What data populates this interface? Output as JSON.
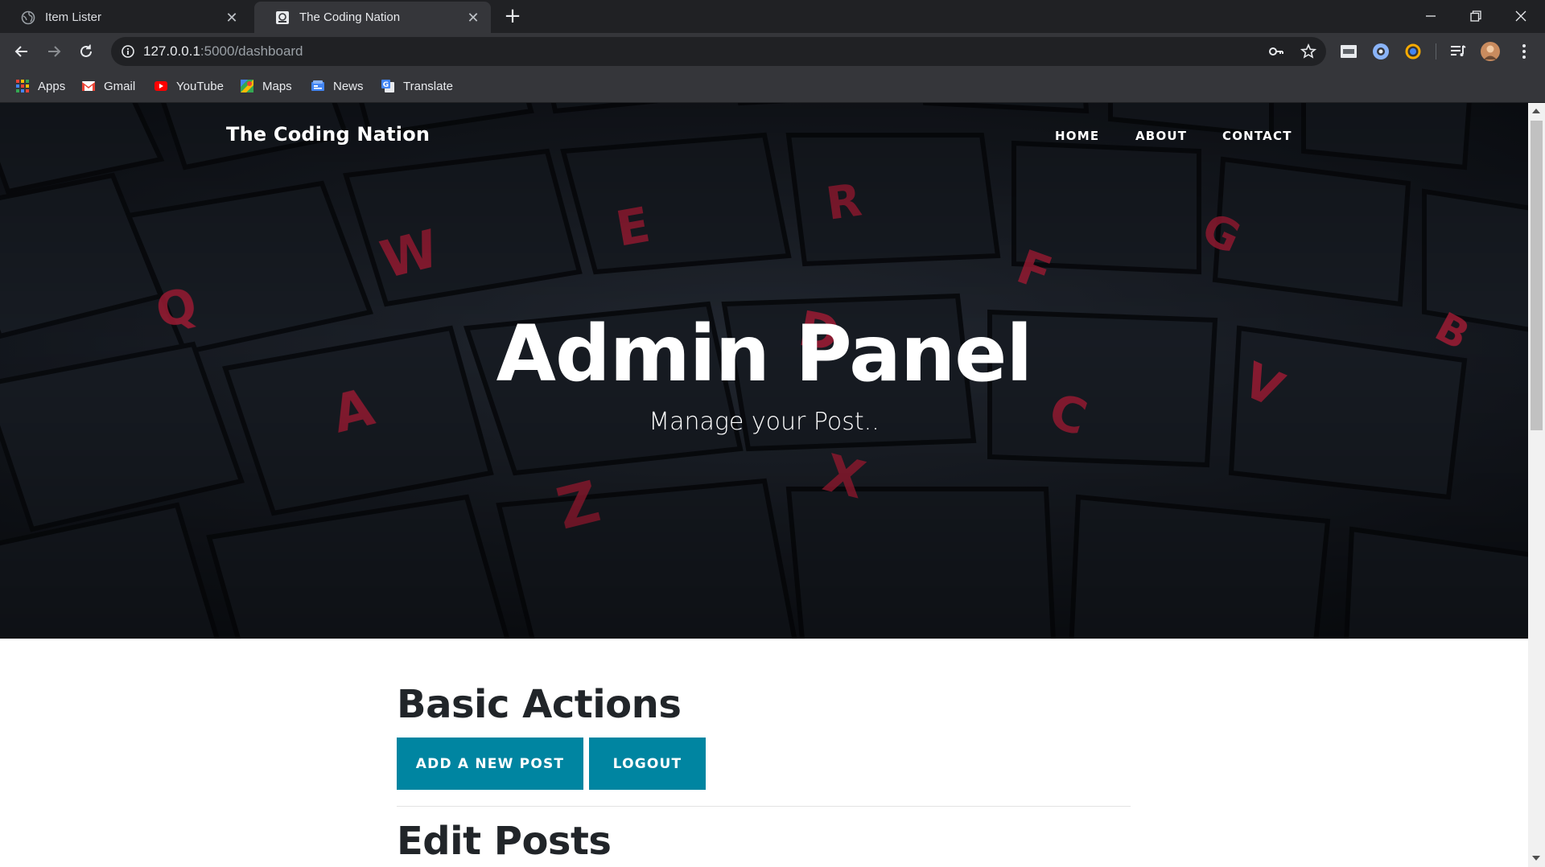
{
  "browser": {
    "tabs": [
      {
        "title": "Item Lister",
        "active": false
      },
      {
        "title": "The Coding Nation",
        "active": true
      }
    ],
    "url_host": "127.0.0.1",
    "url_path": ":5000/dashboard",
    "bookmarks": [
      {
        "label": "Apps",
        "icon": "apps-grid-icon"
      },
      {
        "label": "Gmail",
        "icon": "gmail-icon"
      },
      {
        "label": "YouTube",
        "icon": "youtube-icon"
      },
      {
        "label": "Maps",
        "icon": "maps-icon"
      },
      {
        "label": "News",
        "icon": "news-icon"
      },
      {
        "label": "Translate",
        "icon": "translate-icon"
      }
    ]
  },
  "site": {
    "brand": "The Coding Nation",
    "nav": [
      "HOME",
      "ABOUT",
      "CONTACT"
    ]
  },
  "hero": {
    "title": "Admin Panel",
    "subtitle": "Manage your Post.."
  },
  "basic_actions": {
    "heading": "Basic Actions",
    "buttons": [
      "ADD A NEW POST",
      "LOGOUT"
    ]
  },
  "edit_posts": {
    "heading": "Edit Posts"
  },
  "colors": {
    "accent": "#0085a1",
    "chrome_dark": "#202124",
    "chrome_toolbar": "#35363a"
  }
}
